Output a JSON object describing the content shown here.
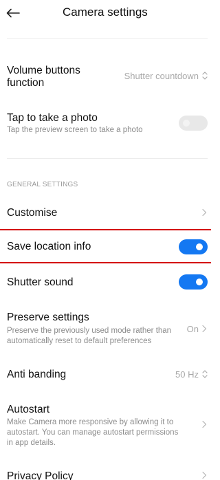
{
  "header": {
    "title": "Camera settings"
  },
  "settings": {
    "volume": {
      "label_line1": "Volume buttons",
      "label_line2": "function",
      "value": "Shutter countdown"
    },
    "tap_photo": {
      "label": "Tap to take a photo",
      "description": "Tap the preview screen to take a photo",
      "enabled": false
    }
  },
  "general": {
    "section_title": "GENERAL SETTINGS",
    "customise": {
      "label": "Customise"
    },
    "save_location": {
      "label": "Save location info",
      "enabled": true
    },
    "shutter_sound": {
      "label": "Shutter sound",
      "enabled": true
    },
    "preserve": {
      "label": "Preserve settings",
      "description_line1": "Preserve the previously used mode rather than",
      "description_line2": "automatically reset to default preferences",
      "value": "On"
    },
    "anti_banding": {
      "label": "Anti banding",
      "value": "50 Hz"
    },
    "autostart": {
      "label": "Autostart",
      "description_line1": "Make Camera more responsive by allowing it to",
      "description_line2": "autostart. You can manage autostart permissions",
      "description_line3": "in app details."
    },
    "privacy": {
      "label": "Privacy Policy"
    }
  },
  "colors": {
    "toggle_on": "#1478f2",
    "highlight": "#d40000"
  },
  "icons": {
    "back": "arrow-left",
    "updown": "chevron-up-down",
    "chevron": "chevron-right"
  }
}
